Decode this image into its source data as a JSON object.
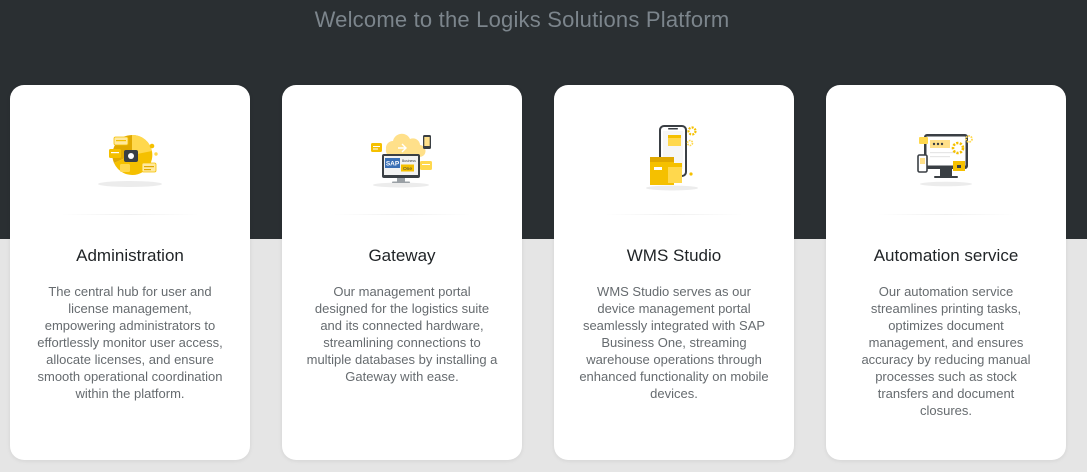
{
  "header": {
    "title": "Welcome to the Logiks Solutions Platform"
  },
  "colors": {
    "hero_background": "#2a2f32",
    "page_background": "#e5e5e5",
    "card_background": "#ffffff",
    "accent": "#f5c000"
  },
  "cards": [
    {
      "title": "Administration",
      "description": "The central hub for user and license management, empowering administrators to effortlessly monitor user access, allocate licenses, and ensure smooth operational coordination within the platform.",
      "icon": "administration-illustration"
    },
    {
      "title": "Gateway",
      "description": "Our management portal designed for the logistics suite and its connected hardware, streamlining connections to multiple databases by installing a Gateway with ease.",
      "icon": "gateway-illustration",
      "illustration_text": {
        "line1": "SAP",
        "line2": "Business",
        "line3": "One"
      }
    },
    {
      "title": "WMS Studio",
      "description": "WMS Studio serves as our device management portal seamlessly integrated with SAP Business One, streaming warehouse operations through enhanced functionality on mobile devices.",
      "icon": "wms-studio-illustration"
    },
    {
      "title": "Automation service",
      "description": "Our automation service streamlines printing tasks, optimizes document management, and ensures accuracy by reducing manual processes such as stock transfers and document closures.",
      "icon": "automation-service-illustration"
    }
  ]
}
